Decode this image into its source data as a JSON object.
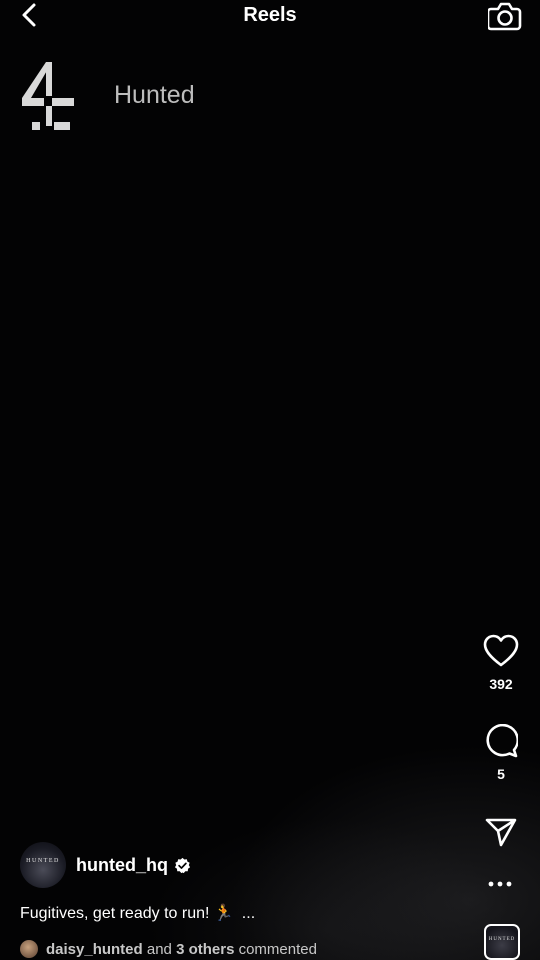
{
  "header": {
    "title": "Reels",
    "back_icon": "chevron-left-icon",
    "camera_icon": "camera-icon"
  },
  "video": {
    "show_title": "Hunted",
    "logo": "channel-4-logo"
  },
  "actions": {
    "likes": "392",
    "comments": "5",
    "like_icon": "heart-icon",
    "comment_icon": "comment-bubble-icon",
    "share_icon": "send-icon",
    "more_icon": "more-dots-icon"
  },
  "author": {
    "username": "hunted_hq",
    "avatar_text": "HUNTED",
    "verified": true
  },
  "caption": {
    "text": "Fugitives, get ready to run! 🏃",
    "more": "..."
  },
  "comments_preview": {
    "user": "daisy_hunted",
    "middle": "and",
    "others": "3 others",
    "suffix": "commented"
  },
  "audio": {
    "thumb_text": "HUNTED"
  },
  "colors": {
    "background": "#000000",
    "text": "#ffffff",
    "muted_text": "#c7c7c7"
  }
}
